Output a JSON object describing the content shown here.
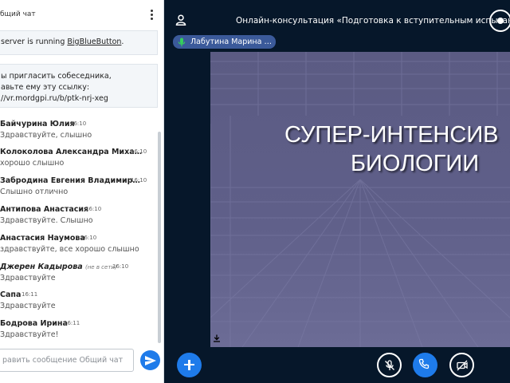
{
  "chat": {
    "title": "бщий чат",
    "system_welcome": {
      "prefix": "server is running ",
      "link": "BigBlueButton",
      "suffix": "."
    },
    "system_invite": {
      "line1": "ы пригласить собеседника,",
      "line2": "авьте ему эту ссылку:",
      "line3": "//vr.mordgpi.ru/b/ptk-nrj-xeg"
    },
    "messages": [
      {
        "name": "Байчурина Юлия",
        "time": "16:10",
        "text": "Здравствуйте, слышно",
        "status": ""
      },
      {
        "name": "Колоколова Александра Миха…",
        "time": "16:10",
        "text": "хорошо слышно",
        "status": ""
      },
      {
        "name": "Забродина Евгения Владимир…",
        "time": "16:10",
        "text": "Слышно отлично",
        "status": ""
      },
      {
        "name": "Антипова Анастасия",
        "time": "16:10",
        "text": "Здравствуйте. Слышно",
        "status": ""
      },
      {
        "name": "Анастасия Наумова",
        "time": "16:10",
        "text": "здравствуйте, все хорошо слышно",
        "status": ""
      },
      {
        "name": "Джерен Кадырова",
        "time": "16:10",
        "text": "Здравствуйте",
        "status": "(не в сети)"
      },
      {
        "name": "Сапа",
        "time": "16:11",
        "text": "Здравствуйте",
        "status": ""
      },
      {
        "name": "Бодрова Ирина",
        "time": "16:11",
        "text": "Здравствуйте!",
        "status": ""
      }
    ],
    "input_placeholder": "равить сообщение Общий чат"
  },
  "meeting": {
    "title": "Онлайн-консультация «Подготовка к вступительным испытан…",
    "more": "•••"
  },
  "talking": {
    "name": "Лабутина Марина …"
  },
  "slide": {
    "line1": "СУПЕР-ИНТЕНСИВ",
    "line2": "БИОЛОГИИ"
  },
  "icons": {
    "user": "user-icon",
    "kebab": "kebab-menu-icon",
    "send": "send-icon",
    "mic": "microphone-icon",
    "mute": "microphone-muted-icon",
    "phone": "phone-icon",
    "camera": "camera-off-icon",
    "plus": "plus-icon",
    "download": "download-icon",
    "record": "record-icon"
  },
  "colors": {
    "primary": "#1E7BEA",
    "background": "#06172A",
    "talker": "#3B5A9A",
    "slide": "#5F5F89"
  }
}
